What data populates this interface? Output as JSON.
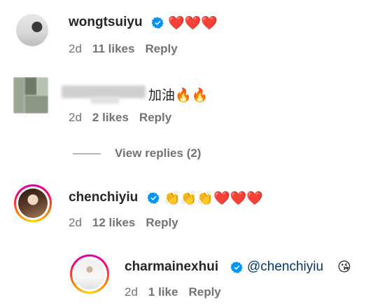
{
  "comments": [
    {
      "username": "wongtsuiyu",
      "verified": true,
      "text": "❤️❤️❤️",
      "time": "2d",
      "likes": "11 likes",
      "reply": "Reply"
    },
    {
      "username": "",
      "verified": false,
      "text": "加油🔥🔥",
      "time": "2d",
      "likes": "2 likes",
      "reply": "Reply"
    },
    {
      "username": "chenchiyiu",
      "verified": true,
      "text": "👏👏👏❤️❤️❤️",
      "time": "2d",
      "likes": "12 likes",
      "reply": "Reply"
    },
    {
      "username": "charmainexhui",
      "verified": true,
      "mention": "@chenchiyiu",
      "text": "😘",
      "time": "2d",
      "likes": "1 like",
      "reply": "Reply"
    }
  ],
  "view_replies": "View replies (2)",
  "icons": {
    "verified": "verified-badge-icon",
    "heart": "red-heart",
    "fire": "fire",
    "clap": "clapping-hands",
    "kiss": "face-blowing-kiss"
  },
  "colors": {
    "verified_blue": "#0095f6",
    "mention_blue": "#00376b",
    "meta_gray": "#737373",
    "text": "#262626"
  }
}
